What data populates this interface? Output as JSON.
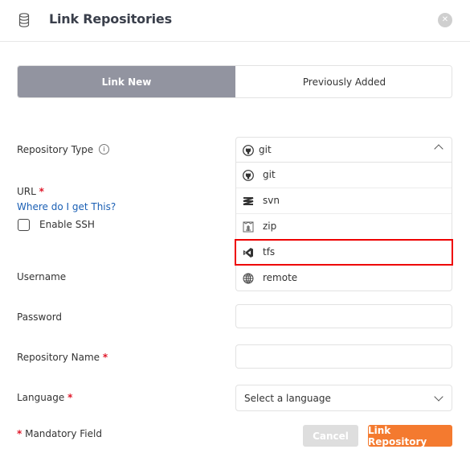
{
  "header": {
    "title": "Link Repositories",
    "icon": "database-icon",
    "close_icon": "close-icon",
    "close_glyph": "✕"
  },
  "tabs": [
    {
      "label": "Link New",
      "active": true
    },
    {
      "label": "Previously Added",
      "active": false
    }
  ],
  "form": {
    "repository_type": {
      "label": "Repository Type",
      "info_glyph": "i",
      "selected": "git",
      "selected_icon": "github-icon",
      "options": [
        {
          "label": "git",
          "icon": "github-icon"
        },
        {
          "label": "svn",
          "icon": "svn-icon"
        },
        {
          "label": "zip",
          "icon": "zip-icon"
        },
        {
          "label": "tfs",
          "icon": "visual-studio-icon",
          "highlighted": true
        },
        {
          "label": "remote",
          "icon": "globe-icon"
        }
      ]
    },
    "url": {
      "label": "URL",
      "required": "*",
      "help_link": "Where do I get This?"
    },
    "enable_ssh": {
      "label": "Enable SSH",
      "checked": false
    },
    "username": {
      "label": "Username",
      "value": ""
    },
    "password": {
      "label": "Password",
      "value": ""
    },
    "repository_name": {
      "label": "Repository Name",
      "required": "*",
      "value": ""
    },
    "language": {
      "label": "Language",
      "required": "*",
      "placeholder": "Select a language"
    },
    "mandatory_note": {
      "star": "*",
      "text": " Mandatory Field"
    }
  },
  "buttons": {
    "cancel": "Cancel",
    "submit": "Link Repository"
  },
  "colors": {
    "active_tab": "#9294a0",
    "primary": "#f47a2f",
    "required": "#e0182a",
    "link": "#1a5fb4",
    "highlight": "#ee0000"
  }
}
